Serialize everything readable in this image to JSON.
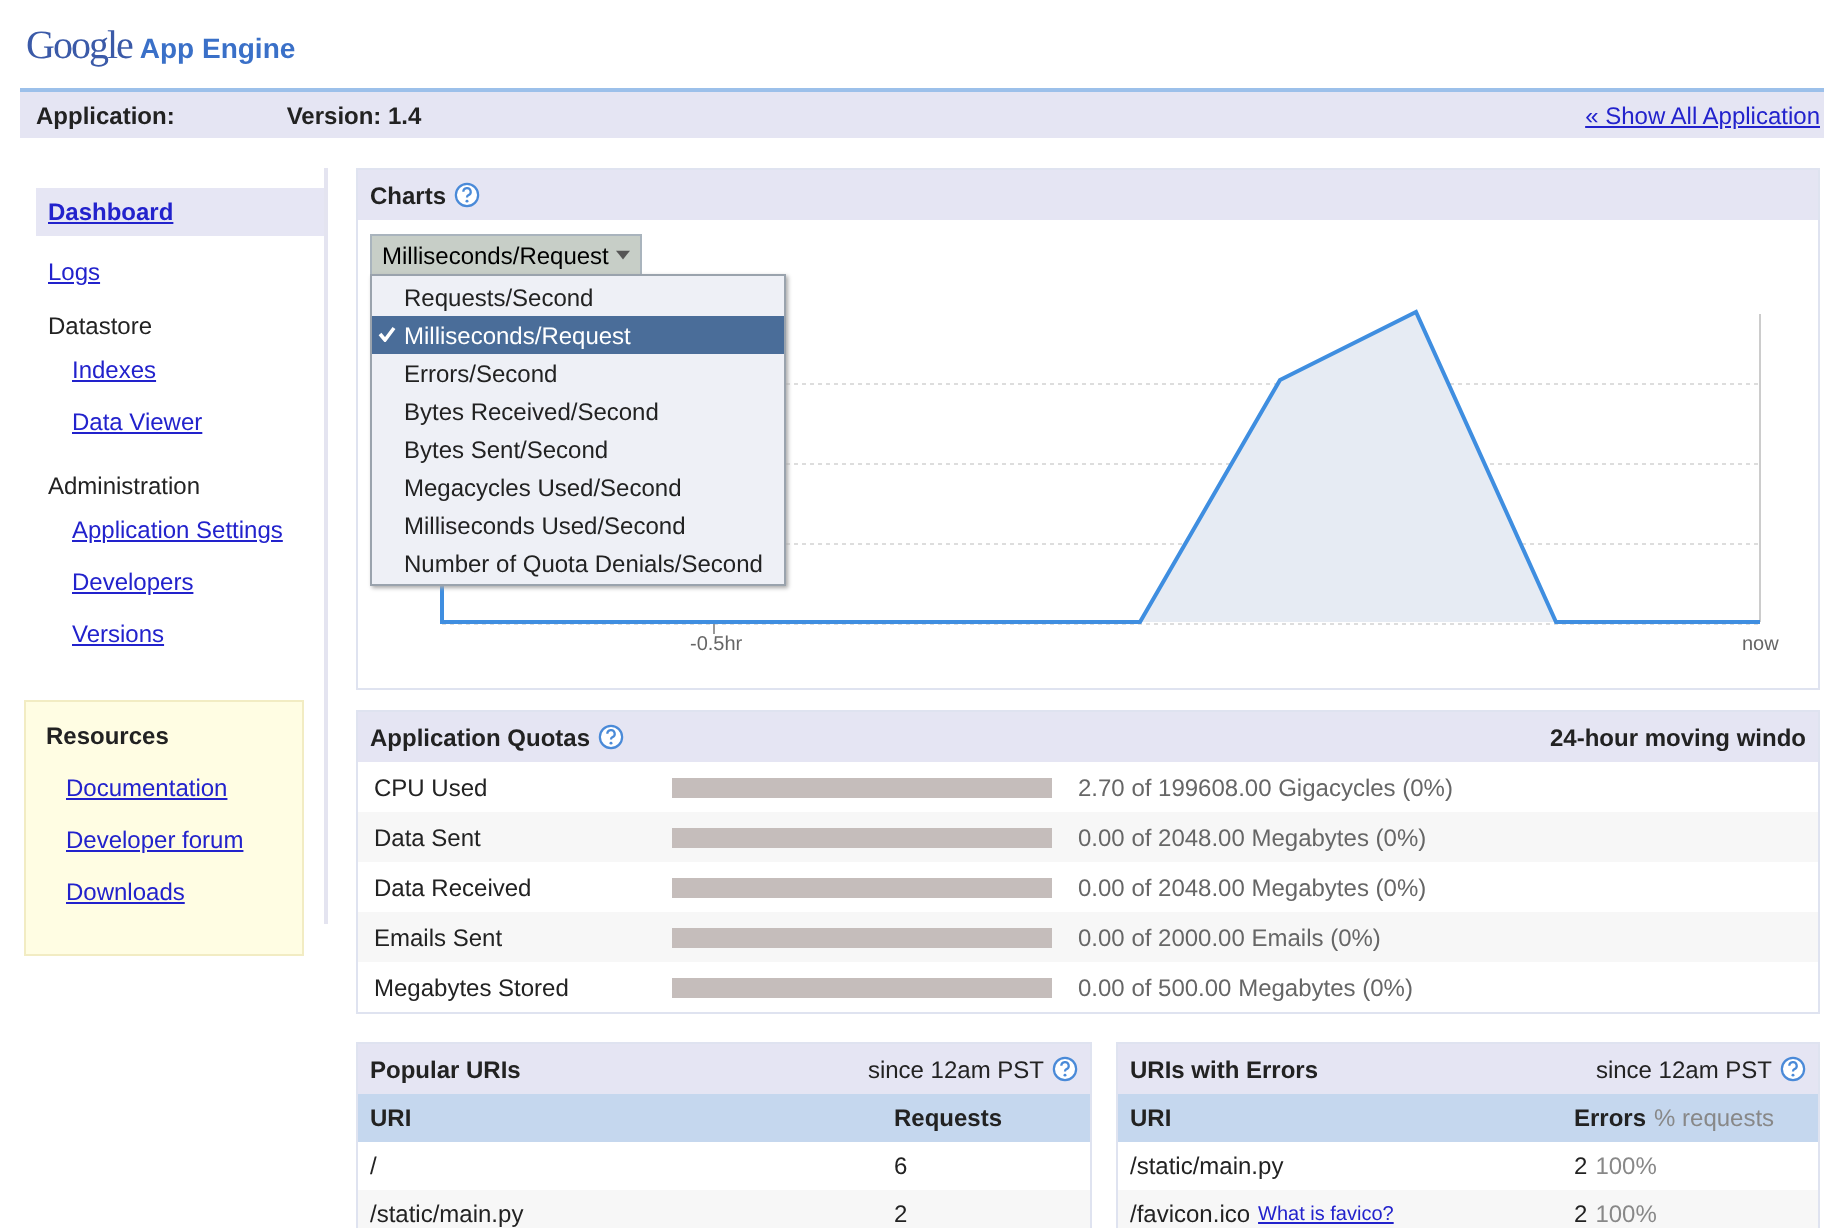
{
  "logo": {
    "brand": "Google",
    "product": "App Engine"
  },
  "header": {
    "application_label": "Application:",
    "version": "Version: 1.4",
    "link": "« Show All Application"
  },
  "sidebar": {
    "items": [
      {
        "kind": "link",
        "label": "Dashboard",
        "selected": true
      },
      {
        "kind": "link",
        "label": "Logs",
        "selected": false
      },
      {
        "kind": "heading",
        "label": "Datastore",
        "children": [
          {
            "label": "Indexes",
            "selected": false
          },
          {
            "label": "Data Viewer",
            "selected": false
          }
        ]
      },
      {
        "kind": "heading",
        "label": "Administration",
        "children": [
          {
            "label": "Application Settings",
            "selected": false
          },
          {
            "label": "Developers",
            "selected": false
          },
          {
            "label": "Versions",
            "selected": false
          }
        ]
      }
    ]
  },
  "resources": {
    "title": "Resources",
    "links": [
      "Documentation",
      "Developer forum",
      "Downloads"
    ]
  },
  "charts": {
    "title": "Charts",
    "dropdown": {
      "value": "Milliseconds/Request",
      "expanded": true,
      "options": [
        {
          "label": "Requests/Second",
          "selected": false
        },
        {
          "label": "Milliseconds/Request",
          "selected": true
        },
        {
          "label": "Errors/Second",
          "selected": false
        },
        {
          "label": "Bytes Received/Second",
          "selected": false
        },
        {
          "label": "Bytes Sent/Second",
          "selected": false
        },
        {
          "label": "Megacycles Used/Second",
          "selected": false
        },
        {
          "label": "Milliseconds Used/Second",
          "selected": false
        },
        {
          "label": "Number of Quota Denials/Second",
          "selected": false
        }
      ]
    },
    "x_labels": [
      "-0.5hr",
      "now"
    ]
  },
  "quotas": {
    "title": "Application Quotas",
    "window": "24-hour moving windo",
    "rows": [
      {
        "name": "CPU Used",
        "level": 0,
        "reading": "2.70 of 199608.00 Gigacycles (0%)"
      },
      {
        "name": "Data Sent",
        "level": 0,
        "reading": "0.00 of 2048.00 Megabytes (0%)"
      },
      {
        "name": "Data Received",
        "level": 0,
        "reading": "0.00 of 2048.00 Megabytes (0%)"
      },
      {
        "name": "Emails Sent",
        "level": 0,
        "reading": "0.00 of 2000.00 Emails (0%)"
      },
      {
        "name": "Megabytes Stored",
        "level": 0,
        "reading": "0.00 of 500.00 Megabytes (0%)"
      }
    ]
  },
  "popular_uris": {
    "title": "Popular URIs",
    "since": "since 12am PST",
    "columns": [
      "URI",
      "Requests"
    ],
    "rows": [
      {
        "uri": "/",
        "requests": "6"
      },
      {
        "uri": "/static/main.py",
        "requests": "2"
      }
    ]
  },
  "uris_with_errors": {
    "title": "URIs with Errors",
    "since": "since 12am PST",
    "columns": [
      "URI",
      "Errors"
    ],
    "columns_note": "% requests",
    "rows": [
      {
        "uri": "/static/main.py",
        "errors": "2",
        "percent": "100%"
      },
      {
        "uri": "/favicon.ico",
        "link": "What is favico?",
        "errors": "2",
        "percent": "100%"
      }
    ]
  }
}
